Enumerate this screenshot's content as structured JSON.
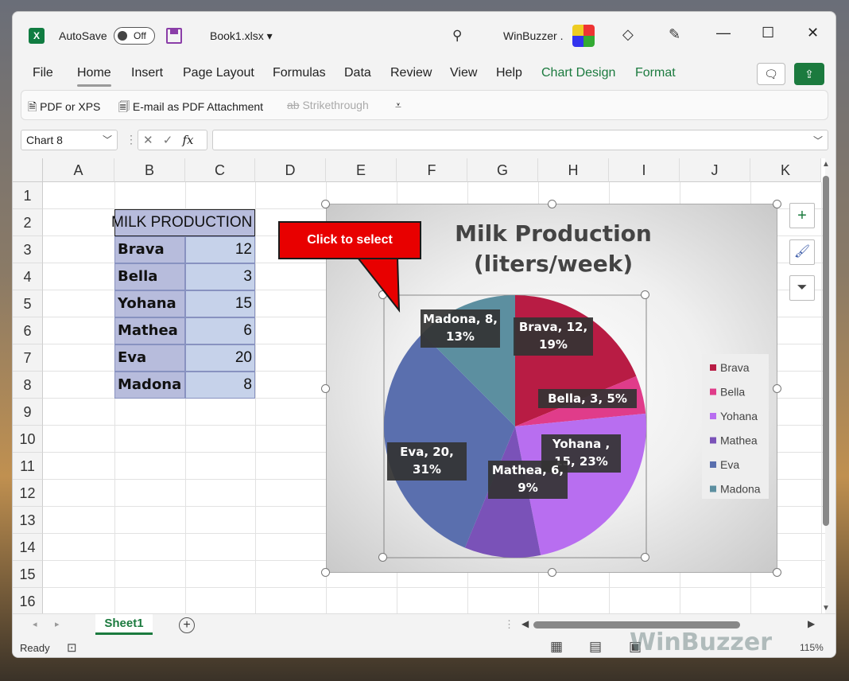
{
  "titlebar": {
    "autosave_label": "AutoSave",
    "toggle_state": "Off",
    "filename": "Book1.xlsx",
    "user": "WinBuzzer .",
    "controls": [
      "minimize-icon",
      "maximize-icon",
      "close-icon"
    ]
  },
  "ribbon": {
    "tabs": [
      {
        "label": "File"
      },
      {
        "label": "Home"
      },
      {
        "label": "Insert"
      },
      {
        "label": "Page Layout"
      },
      {
        "label": "Formulas"
      },
      {
        "label": "Data"
      },
      {
        "label": "Review"
      },
      {
        "label": "View"
      },
      {
        "label": "Help"
      },
      {
        "label": "Chart Design"
      },
      {
        "label": "Format"
      }
    ],
    "active_tab": "Home",
    "accent": "#1b7a3e"
  },
  "toolbar": {
    "pdf_xps": "PDF or XPS",
    "email_pdf": "E-mail as PDF Attachment",
    "strikethrough": "Strikethrough"
  },
  "formula_bar": {
    "name_box": "Chart 8",
    "fx": "fx",
    "value": ""
  },
  "grid": {
    "columns": [
      "A",
      "B",
      "C",
      "D",
      "E",
      "F",
      "G",
      "H",
      "I",
      "J",
      "K"
    ],
    "rows": [
      "1",
      "2",
      "3",
      "4",
      "5",
      "6",
      "7",
      "8",
      "9",
      "10",
      "11",
      "12",
      "13",
      "14",
      "15",
      "16"
    ],
    "table_header": "MILK PRODUCTION",
    "table_rows": [
      {
        "name": "Brava",
        "value": "12"
      },
      {
        "name": "Bella",
        "value": "3"
      },
      {
        "name": "Yohana",
        "value": "15"
      },
      {
        "name": "Mathea",
        "value": "6"
      },
      {
        "name": "Eva",
        "value": "20"
      },
      {
        "name": "Madona",
        "value": "8"
      }
    ]
  },
  "callout": {
    "text": "Click to select",
    "color": "#e80000"
  },
  "chart_data": {
    "type": "pie",
    "title": "Milk Production (liters/week)",
    "title_lines": [
      "Milk Production",
      "(liters/week)"
    ],
    "categories": [
      "Brava",
      "Bella",
      "Yohana",
      "Mathea",
      "Eva",
      "Madona"
    ],
    "values": [
      12,
      3,
      15,
      6,
      20,
      8
    ],
    "percents": [
      "19%",
      "5%",
      "23%",
      "9%",
      "31%",
      "13%"
    ],
    "data_labels": [
      [
        "Brava, 12,",
        "19%"
      ],
      [
        "Bella, 3, 5%"
      ],
      [
        "Yohana ,",
        "15, 23%"
      ],
      [
        "Mathea, 6,",
        "9%"
      ],
      [
        "Eva, 20,",
        "31%"
      ],
      [
        "Madona, 8,",
        "13%"
      ]
    ],
    "colors": [
      "#b81c44",
      "#e03c8a",
      "#b86ef0",
      "#7a52b8",
      "#5a6fae",
      "#5c8fa0"
    ],
    "legend": "right"
  },
  "sheets": {
    "active": "Sheet1"
  },
  "status": {
    "ready": "Ready",
    "zoom": "115%"
  },
  "watermark": "WinBuzzer"
}
